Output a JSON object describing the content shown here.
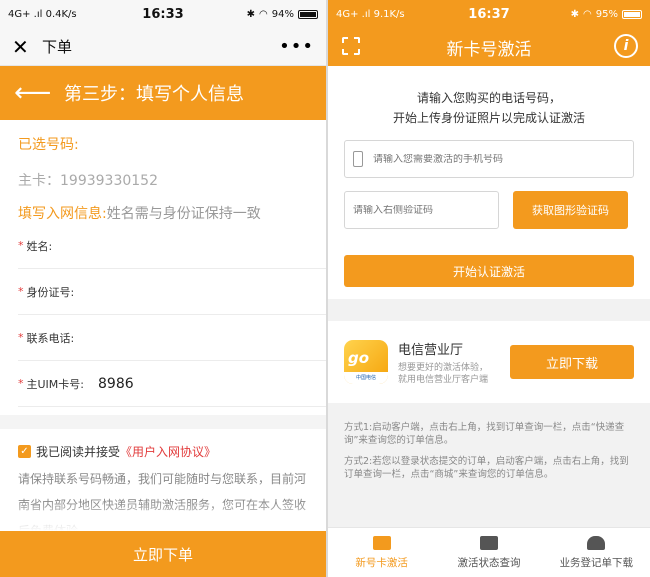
{
  "left": {
    "status": {
      "network": "4G+ .ıl  0.4K/s",
      "time": "16:33",
      "battery": "94%",
      "battery_level": 0.94
    },
    "wechat_bar": {
      "close_glyph": "✕",
      "title": "下单",
      "more_glyph": "•••"
    },
    "step_bar": {
      "back_glyph": "⟵",
      "title": "第三步：填写个人信息"
    },
    "selected_label": "已选号码:",
    "main_card": "主卡：19939330152",
    "fill_label": "填写入网信息:",
    "fill_hint": "姓名需与身份证保持一致",
    "required_mark": "*",
    "form": [
      {
        "label": "姓名:",
        "value": ""
      },
      {
        "label": "身份证号:",
        "value": ""
      },
      {
        "label": "联系电话:",
        "value": ""
      },
      {
        "label": "主UIM卡号:",
        "value": "8986"
      }
    ],
    "agreement": {
      "checkbox_glyph": "✓",
      "text": "我已阅读并接受",
      "link": "《用户入网协议》",
      "checked": true
    },
    "notice": "请保持联系号码畅通，我们可能随时与您联系，目前河南省内部分地区快递员辅助激活服务，您可在本人签收后免费体验",
    "submit_label": "立即下单",
    "accent_color": "#f39a1e"
  },
  "right": {
    "status": {
      "network": "4G+ .ıl  9.1K/s",
      "time": "16:37",
      "battery": "95%",
      "battery_level": 0.95
    },
    "header": {
      "title": "新卡号激活",
      "info_glyph": "i"
    },
    "intro_line1": "请输入您购买的电话号码，",
    "intro_line2": "开始上传身份证照片以完成认证激活",
    "phone_placeholder": "请输入您需要激活的手机号码",
    "captcha_placeholder": "请输入右侧验证码",
    "get_code_label": "获取图形验证码",
    "start_label": "开始认证激活",
    "app": {
      "logo_text": "go",
      "logo_strip": "中国电信",
      "name": "电信营业厅",
      "desc": "想要更好的激活体验，就用电信营业厅客户端",
      "download_label": "立即下载"
    },
    "method1": "方式1:启动客户端，点击右上角，找到订单查询一栏，点击“快递查询”来查询您的订单信息。",
    "method2": "方式2:若您以登录状态提交的订单，启动客户端，点击右上角，找到订单查询一栏，点击“商城”来查询您的订单信息。",
    "tabs": [
      {
        "label": "新号卡激活",
        "active": true,
        "icon": "sim-card-icon"
      },
      {
        "label": "激活状态查询",
        "active": false,
        "icon": "search-list-icon"
      },
      {
        "label": "业务登记单下载",
        "active": false,
        "icon": "cloud-download-icon"
      }
    ]
  }
}
